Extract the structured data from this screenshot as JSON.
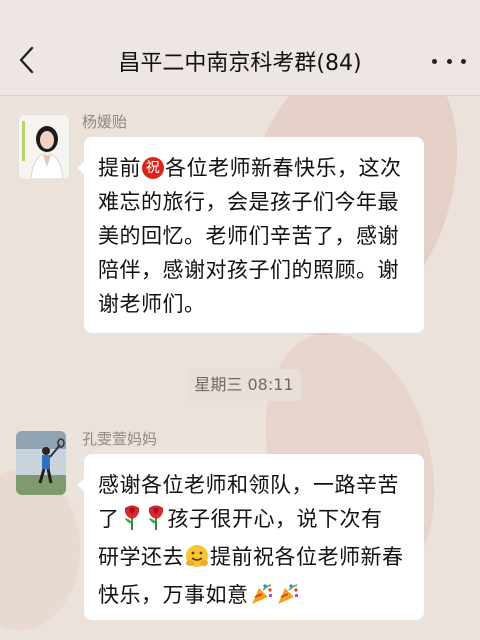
{
  "header": {
    "title": "昌平二中南京科考群(84)",
    "back_icon": "chevron-left-icon",
    "more_icon": "more-dots-icon"
  },
  "messages": [
    {
      "sender": "杨媛贻",
      "avatar": "avatar-woman-photo",
      "lines": {
        "l1_pre": "提前",
        "l1_badge": "祝",
        "l1_post": "各位老师新春快乐，这次",
        "l2": "难忘的旅行，会是孩子们今年最",
        "l3": "美的回忆。老师们辛苦了，感谢",
        "l4": "陪伴，感谢对孩子们的照顾。谢",
        "l5": "谢老师们。"
      }
    },
    {
      "sender": "孔雯萱妈妈",
      "avatar": "avatar-badminton-photo",
      "lines": {
        "l1": "感谢各位老师和领队，一路辛苦",
        "l2_pre": "了",
        "l2_post": "孩子很开心，说下次有",
        "l3_pre": "研学还去",
        "l3_post": "提前祝各位老师新春",
        "l4": "快乐，万事如意"
      },
      "emojis": [
        "rose-emoji",
        "rose-emoji",
        "hugging-face-emoji",
        "party-popper-emoji",
        "party-popper-emoji"
      ]
    }
  ],
  "timestamp": "星期三 08:11"
}
